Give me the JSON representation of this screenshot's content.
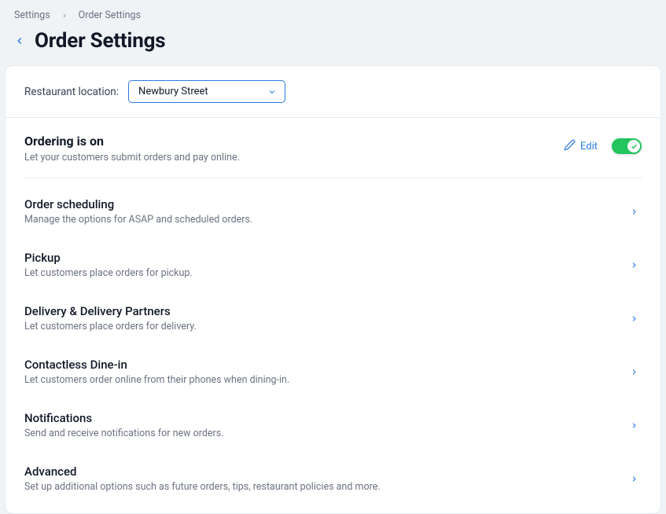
{
  "breadcrumb": {
    "root": "Settings",
    "current": "Order Settings"
  },
  "title": "Order Settings",
  "location": {
    "label": "Restaurant location:",
    "selected": "Newbury Street"
  },
  "ordering": {
    "title": "Ordering is on",
    "desc": "Let your customers submit orders and pay online.",
    "edit_label": "Edit"
  },
  "rows": [
    {
      "title": "Order scheduling",
      "desc": "Manage the options for ASAP and scheduled orders."
    },
    {
      "title": "Pickup",
      "desc": "Let customers place orders for pickup."
    },
    {
      "title": "Delivery & Delivery Partners",
      "desc": "Let customers place orders for delivery."
    },
    {
      "title": "Contactless Dine-in",
      "desc": "Let customers order online from their phones when dining-in."
    },
    {
      "title": "Notifications",
      "desc": "Send and receive notifications for new orders."
    },
    {
      "title": "Advanced",
      "desc": "Set up additional options such as future orders, tips, restaurant policies and more."
    }
  ]
}
